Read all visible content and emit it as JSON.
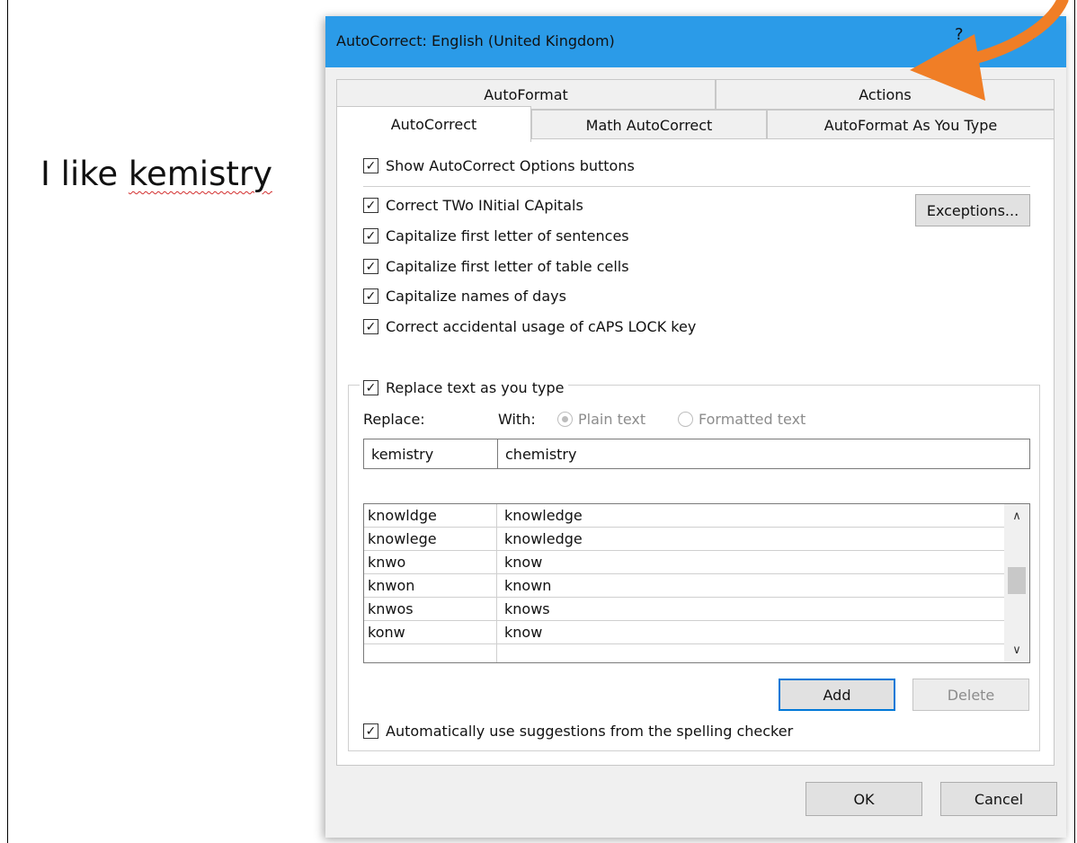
{
  "document": {
    "text_prefix": "I like ",
    "misspelled_word": "kemistry"
  },
  "dialog": {
    "title": "AutoCorrect: English (United Kingdom)",
    "help_glyph": "?",
    "close_glyph": "×",
    "tabs_back": [
      "AutoFormat",
      "Actions"
    ],
    "tabs_front": [
      "AutoCorrect",
      "Math AutoCorrect",
      "AutoFormat As You Type"
    ],
    "active_tab": "AutoCorrect",
    "options": {
      "show_buttons": "Show AutoCorrect Options buttons",
      "two_initial_caps": "Correct TWo INitial CApitals",
      "first_letter_sentences": "Capitalize first letter of sentences",
      "first_letter_table_cells": "Capitalize first letter of table cells",
      "names_of_days": "Capitalize names of days",
      "caps_lock": "Correct accidental usage of cAPS LOCK key"
    },
    "exceptions_button": "Exceptions...",
    "replace_section": {
      "checkbox_label": "Replace text as you type",
      "replace_label": "Replace:",
      "with_label": "With:",
      "plain_text": "Plain text",
      "formatted_text": "Formatted text",
      "selected_format": "Plain text",
      "replace_value": "kemistry",
      "with_value": "chemistry",
      "entries": [
        {
          "replace": "knowldge",
          "with": "knowledge"
        },
        {
          "replace": "knowlege",
          "with": "knowledge"
        },
        {
          "replace": "knwo",
          "with": "know"
        },
        {
          "replace": "knwon",
          "with": "known"
        },
        {
          "replace": "knwos",
          "with": "knows"
        },
        {
          "replace": "konw",
          "with": "know"
        }
      ],
      "add_button": "Add",
      "delete_button": "Delete",
      "spelling_suggestions": "Automatically use suggestions from the spelling checker"
    },
    "ok_button": "OK",
    "cancel_button": "Cancel"
  },
  "colors": {
    "titlebar": "#2b9be8",
    "arrow": "#f07e26",
    "squiggle": "#d32f2f",
    "default_button_border": "#0078d7"
  }
}
